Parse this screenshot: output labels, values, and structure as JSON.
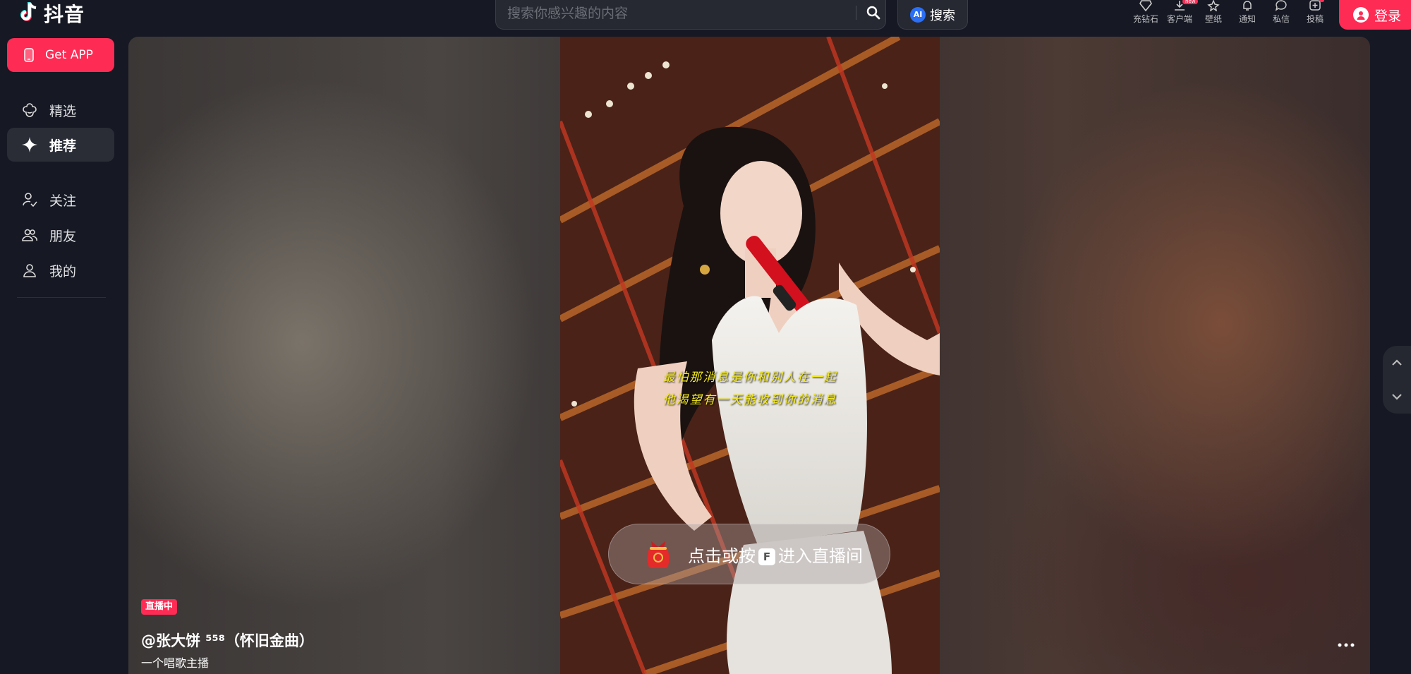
{
  "header": {
    "logo_text": "抖音",
    "search_placeholder": "搜索你感兴趣的内容",
    "ai_badge": "AI",
    "ai_search_label": "搜索",
    "top_items": [
      {
        "label": "充钻石",
        "icon": "diamond-icon"
      },
      {
        "label": "客户端",
        "icon": "download-icon",
        "badge": "new"
      },
      {
        "label": "壁纸",
        "icon": "wallpaper-icon"
      },
      {
        "label": "通知",
        "icon": "bell-icon"
      },
      {
        "label": "私信",
        "icon": "message-icon"
      },
      {
        "label": "投稿",
        "icon": "upload-icon",
        "dot": true
      }
    ],
    "login_label": "登录"
  },
  "sidebar": {
    "get_app_label": "Get APP",
    "items": [
      {
        "label": "精选",
        "icon": "featured-icon",
        "active": false
      },
      {
        "label": "推荐",
        "icon": "sparkle-icon",
        "active": true
      },
      {
        "label": "关注",
        "icon": "follow-icon",
        "active": false
      },
      {
        "label": "朋友",
        "icon": "friends-icon",
        "active": false
      },
      {
        "label": "我的",
        "icon": "profile-icon",
        "active": false
      }
    ]
  },
  "video": {
    "lyrics": [
      "最怕那消息是你和别人在一起",
      "他渴望有一天能收到你的消息"
    ],
    "enter_live_before": "点击或按",
    "enter_live_key": "F",
    "enter_live_after": "进入直播间",
    "live_badge": "直播中",
    "streamer": "@张大饼 ⁵⁵⁸（怀旧金曲）",
    "description": "一个唱歌主播"
  },
  "colors": {
    "background": "#161823",
    "accent": "#fe2c55",
    "lyric": "#f4ea22"
  }
}
